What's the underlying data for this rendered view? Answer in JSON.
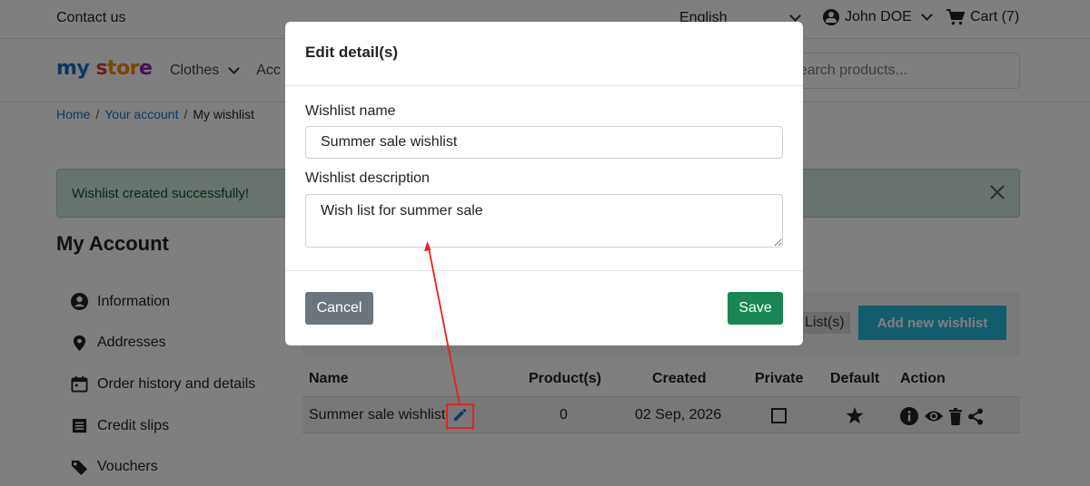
{
  "topbar": {
    "contact": "Contact us",
    "language": "English",
    "user_name": "John DOE",
    "cart_label": "Cart (7)"
  },
  "header": {
    "logo_parts": [
      "my",
      " ",
      "s",
      "tor",
      "e"
    ],
    "nav_clothes": "Clothes",
    "nav_accessories_partial": "Acc",
    "search_placeholder": "Search products..."
  },
  "breadcrumb": {
    "home": "Home",
    "account": "Your account",
    "current": "My wishlist"
  },
  "alert": {
    "message": "Wishlist created successfully!"
  },
  "account": {
    "title": "My Account",
    "menu": [
      "Information",
      "Addresses",
      "Order history and details",
      "Credit slips",
      "Vouchers"
    ]
  },
  "wishlist": {
    "list_badge": "List(s)",
    "add_button": "Add new wishlist",
    "columns": {
      "name": "Name",
      "products": "Product(s)",
      "created": "Created",
      "private": "Private",
      "default": "Default",
      "action": "Action"
    },
    "rows": [
      {
        "name": "Summer sale wishlist",
        "products": "0",
        "created": "02 Sep, 2026",
        "private": false,
        "default": true
      }
    ]
  },
  "modal": {
    "title": "Edit detail(s)",
    "name_label": "Wishlist name",
    "name_value": "Summer sale wishlist",
    "description_label": "Wishlist description",
    "description_value": "Wish list for summer sale",
    "cancel": "Cancel",
    "save": "Save"
  },
  "colors": {
    "accent_blue": "#1b6ec2",
    "add_button_bg": "#24b9d7",
    "save_bg": "#198754",
    "cancel_bg": "#6c757d",
    "alert_bg": "#d1e7dd",
    "annotation": "#e02424"
  },
  "icons": {
    "user": "user-circle-icon",
    "cart": "cart-icon",
    "edit": "pencil-icon",
    "info": "info-icon",
    "view": "eye-icon",
    "delete": "trash-icon",
    "share": "share-icon",
    "default": "star-icon"
  }
}
